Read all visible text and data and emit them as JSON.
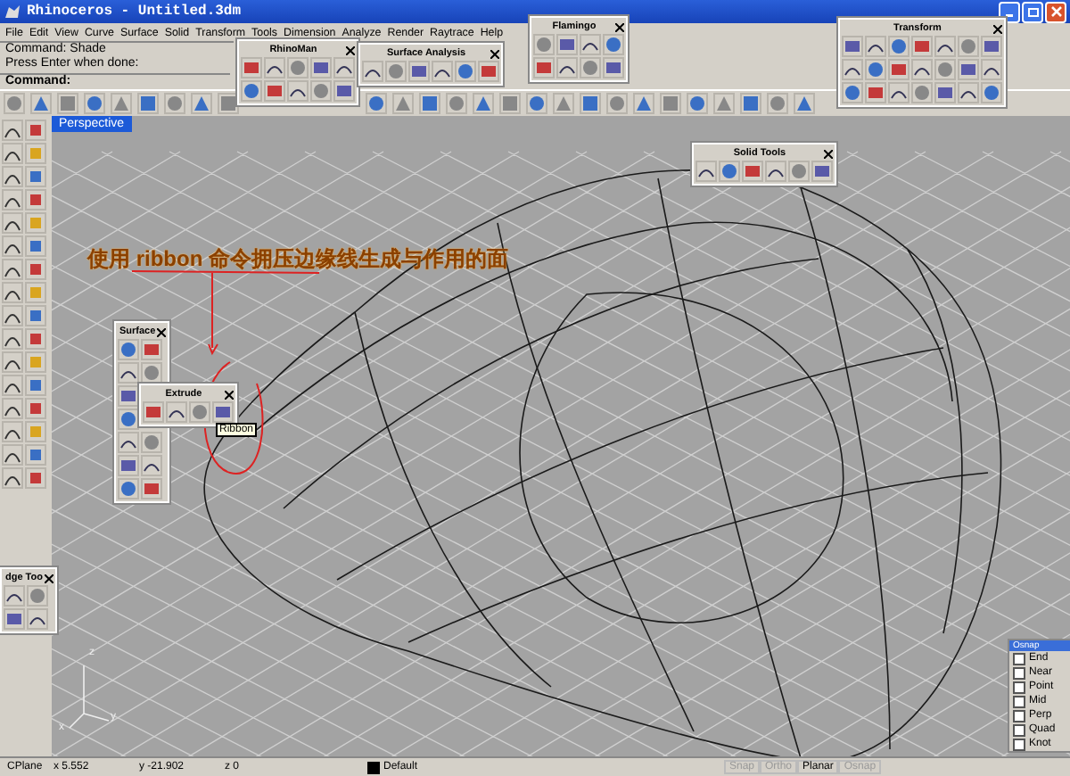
{
  "window": {
    "title": "Rhinoceros - Untitled.3dm"
  },
  "menu": [
    "File",
    "Edit",
    "View",
    "Curve",
    "Surface",
    "Solid",
    "Transform",
    "Tools",
    "Dimension",
    "Analyze",
    "Render",
    "Raytrace",
    "Help"
  ],
  "command_history": [
    "Command: Shade",
    "Press Enter when done:"
  ],
  "command_prompt": "Command:",
  "viewport": {
    "title": "Perspective",
    "annotation": "使用 ribbon 命令拥压边缘线生成与作用的面",
    "axes": [
      "z",
      "x",
      "y"
    ]
  },
  "floating_toolbars": [
    {
      "title": "RhinoMan"
    },
    {
      "title": "Surface Analysis"
    },
    {
      "title": "Flamingo"
    },
    {
      "title": "Transform"
    },
    {
      "title": "Solid Tools"
    },
    {
      "title": "Surface"
    },
    {
      "title": "Extrude"
    },
    {
      "title": "dge Too"
    }
  ],
  "tooltip": "Ribbon",
  "osnap": {
    "title": "Osnap",
    "items": [
      {
        "label": "End",
        "checked": false
      },
      {
        "label": "Near",
        "checked": false
      },
      {
        "label": "Point",
        "checked": false
      },
      {
        "label": "Mid",
        "checked": false
      },
      {
        "label": "Perp",
        "checked": false
      },
      {
        "label": "Quad",
        "checked": false
      },
      {
        "label": "Knot",
        "checked": false
      }
    ]
  },
  "status_bar": {
    "cplane": "CPlane",
    "x": "x 5.552",
    "y": "y -21.902",
    "z": "z 0",
    "layer": "Default",
    "toggles": [
      {
        "label": "Snap",
        "on": false
      },
      {
        "label": "Ortho",
        "on": false
      },
      {
        "label": "Planar",
        "on": true
      },
      {
        "label": "Osnap",
        "on": false
      }
    ]
  }
}
